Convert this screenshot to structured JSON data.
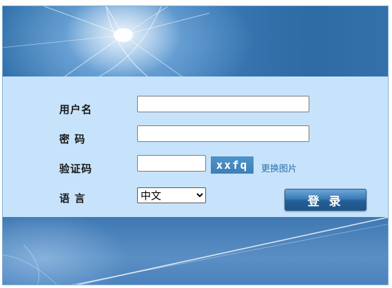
{
  "form": {
    "username_label": "用户名",
    "password_label": "密 码",
    "captcha_label": "验证码",
    "language_label": "语 言",
    "username_value": "",
    "password_value": "",
    "captcha_value": "",
    "captcha_image_text": "xxfq",
    "refresh_captcha_label": "更换图片",
    "language_selected": "中文",
    "login_button_label": "登 录"
  },
  "colors": {
    "panel_background": "#c6e3fb",
    "banner_blue": "#3a78b4",
    "link_blue": "#2f6fa8"
  }
}
